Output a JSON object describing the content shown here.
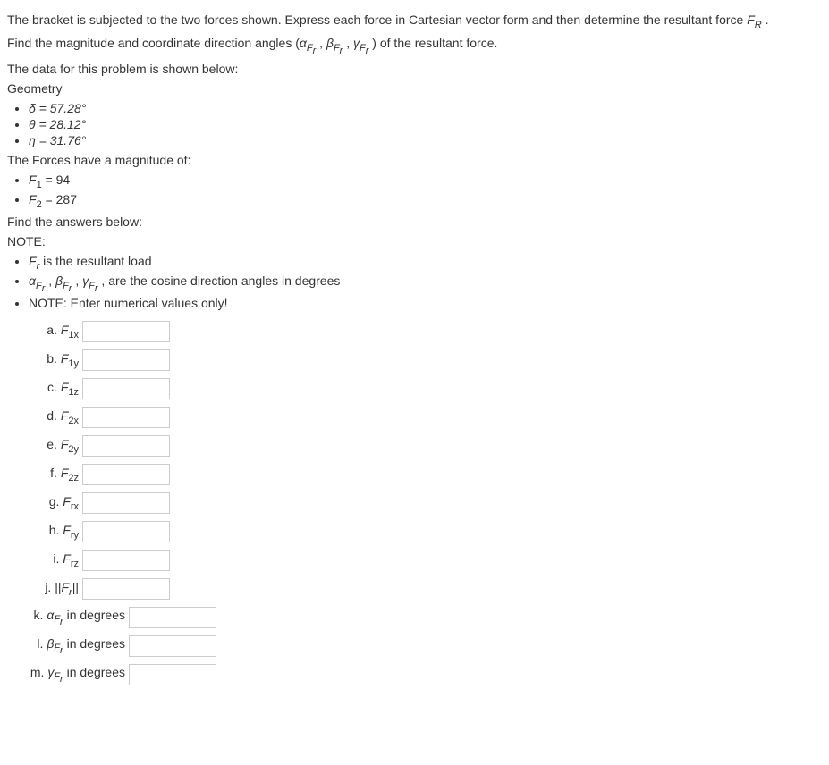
{
  "intro": {
    "p1_prefix": "The bracket is subjected to the two forces shown. Express each force in Cartesian vector form and then determine the resultant force ",
    "p1_var": "F",
    "p1_sub": "R",
    "p1_suffix": " .",
    "p2_prefix": "Find the magnitude and coordinate direction angles (",
    "p2_a": "α",
    "p2_asub": "F",
    "p2_asubsub": "r",
    "p2_c1": " , ",
    "p2_b": "β",
    "p2_bsub": "F",
    "p2_bsubsub": "r",
    "p2_c2": " , ",
    "p2_g": "γ",
    "p2_gsub": "F",
    "p2_gsubsub": "r",
    "p2_suffix": " ) of the resultant force.",
    "p3": "The data for this problem is shown below:",
    "geom_label": "Geometry"
  },
  "geom": {
    "delta": "δ = 57.28°",
    "theta": "θ = 28.12°",
    "eta": "η = 31.76°"
  },
  "forces": {
    "header": "The Forces have a magnitude of:",
    "f1_prefix": "F",
    "f1_sub": "1",
    "f1_val": " = 94",
    "f2_prefix": "F",
    "f2_sub": "2",
    "f2_val": " = 287"
  },
  "answers_header": "Find the answers below:",
  "note_label": "NOTE:",
  "notes": {
    "n1_prefix": "F",
    "n1_sub": "r",
    "n1_text": " is the resultant load",
    "n2_a": "α",
    "n2_asub": "F",
    "n2_asubsub": "r",
    "n2_c1": " , ",
    "n2_b": "β",
    "n2_bsub": "F",
    "n2_bsubsub": "r",
    "n2_c2": " , ",
    "n2_g": "γ",
    "n2_gsub": "F",
    "n2_gsubsub": "r",
    "n2_text": " , are the cosine direction angles in degrees",
    "n3": "NOTE: Enter numerical values only!"
  },
  "ans": {
    "a_l": "a. ",
    "a_v": "F",
    "a_s": "1x",
    "b_l": "b. ",
    "b_v": "F",
    "b_s": "1y",
    "c_l": "c. ",
    "c_v": "F",
    "c_s": "1z",
    "d_l": "d. ",
    "d_v": "F",
    "d_s": "2x",
    "e_l": "e. ",
    "e_v": "F",
    "e_s": "2y",
    "f_l": "f. ",
    "f_v": "F",
    "f_s": "2z",
    "g_l": "g. ",
    "g_v": "F",
    "g_s": "rx",
    "h_l": "h. ",
    "h_v": "F",
    "h_s": "ry",
    "i_l": "i. ",
    "i_v": "F",
    "i_s": "rz",
    "j_l": "j. ||",
    "j_v": "F",
    "j_s": "r",
    "j_l2": "||",
    "k_l": "k. ",
    "k_v": "α",
    "k_s": "F",
    "k_ss": "r",
    "k_t": " in degrees",
    "l_l": "l. ",
    "l_v": "β",
    "l_s": "F",
    "l_ss": "r",
    "l_t": " in degrees",
    "m_l": "m. ",
    "m_v": "γ",
    "m_s": "F",
    "m_ss": "r",
    "m_t": " in degrees"
  }
}
